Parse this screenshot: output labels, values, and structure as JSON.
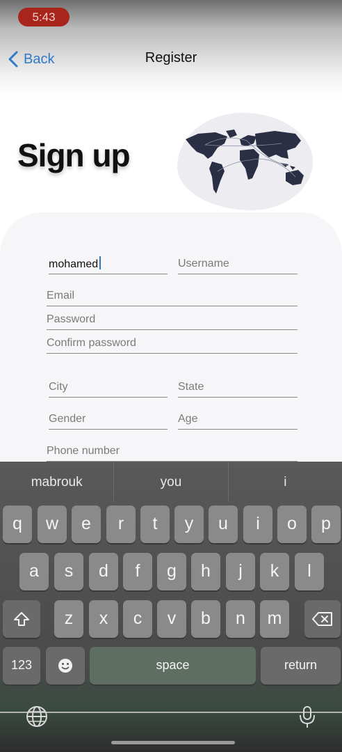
{
  "status_bar": {
    "time": "5:43"
  },
  "nav": {
    "back_label": "Back",
    "title": "Register"
  },
  "heading": "Sign up",
  "form": {
    "first_name_value": "mohamed",
    "username_placeholder": "Username",
    "email_placeholder": "Email",
    "password_placeholder": "Password",
    "confirm_password_placeholder": "Confirm password",
    "city_placeholder": "City",
    "state_placeholder": "State",
    "gender_placeholder": "Gender",
    "age_placeholder": "Age",
    "phone_placeholder": "Phone number"
  },
  "keyboard": {
    "suggestions": [
      "mabrouk",
      "you",
      "i"
    ],
    "row1": [
      "q",
      "w",
      "e",
      "r",
      "t",
      "y",
      "u",
      "i",
      "o",
      "p"
    ],
    "row2": [
      "a",
      "s",
      "d",
      "f",
      "g",
      "h",
      "j",
      "k",
      "l"
    ],
    "row3": [
      "z",
      "x",
      "c",
      "v",
      "b",
      "n",
      "m"
    ],
    "numbers_label": "123",
    "space_label": "space",
    "return_label": "return"
  },
  "icons": [
    "chevron-left-icon",
    "world-map-illustration",
    "shift-icon",
    "backspace-icon",
    "emoji-icon",
    "globe-icon",
    "microphone-icon"
  ]
}
